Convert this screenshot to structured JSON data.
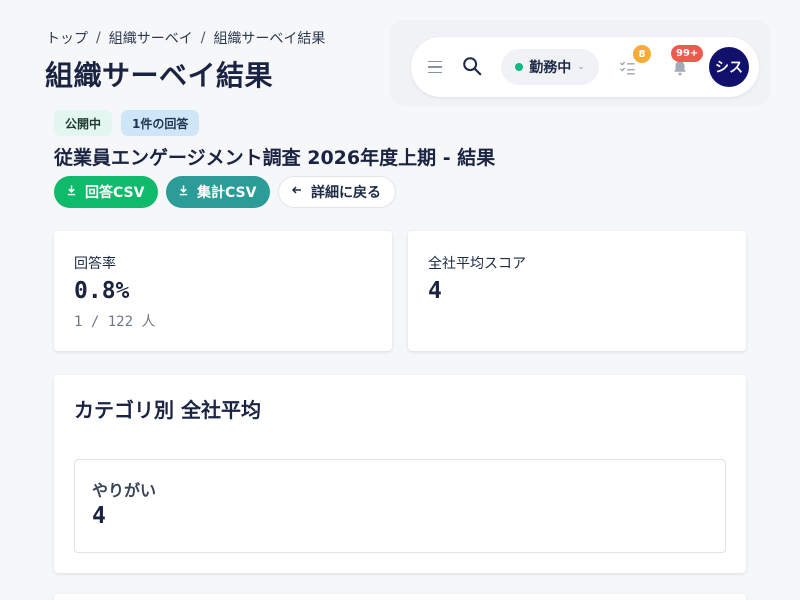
{
  "breadcrumb": {
    "items": [
      "トップ",
      "組織サーベイ",
      "組織サーベイ結果"
    ],
    "separator": "/"
  },
  "page": {
    "title": "組織サーベイ結果"
  },
  "topbar": {
    "status_label": "勤務中",
    "tasks_badge": "8",
    "notifications_badge": "99+",
    "avatar_initials": "シス",
    "icons": [
      "menu-icon",
      "search-icon",
      "chevron-down-icon",
      "tasks-icon",
      "bell-icon"
    ]
  },
  "tags": {
    "status": "公開中",
    "responses": "1件の回答"
  },
  "survey": {
    "title": "従業員エンゲージメント調査 2026年度上期 - 結果"
  },
  "actions": {
    "responses_csv": "回答CSV",
    "summary_csv": "集計CSV",
    "back": "詳細に戻る"
  },
  "stats": {
    "response_rate": {
      "label": "回答率",
      "value": "0.8%",
      "sub": "1 / 122 人"
    },
    "average_score": {
      "label": "全社平均スコア",
      "value": "4"
    }
  },
  "category_section": {
    "title": "カテゴリ別 全社平均",
    "items": [
      {
        "name": "やりがい",
        "value": "4"
      }
    ]
  },
  "colors": {
    "primary_green": "#0fba6b",
    "teal": "#2b9c97",
    "avatar_bg": "#11116b",
    "status_dot": "#10b981",
    "badge_orange": "#f6ad37",
    "badge_red": "#ef5a4f"
  }
}
